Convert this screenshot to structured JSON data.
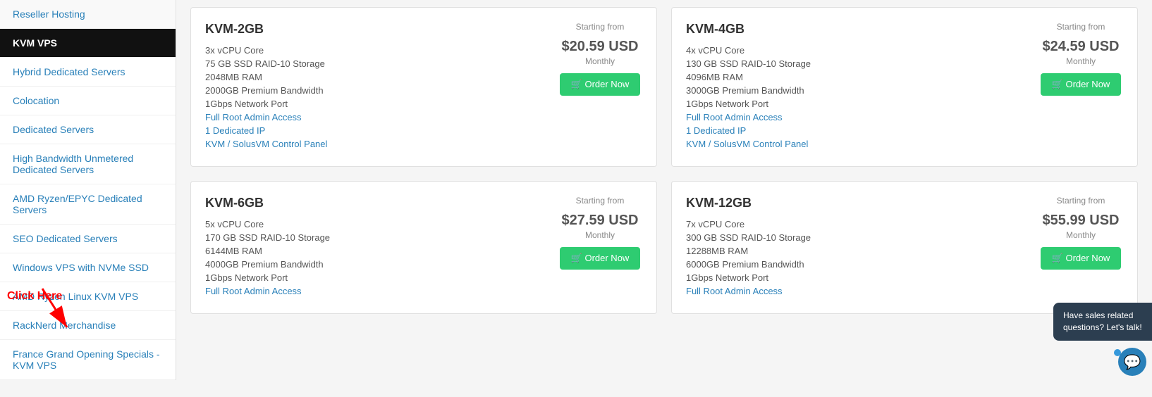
{
  "sidebar": {
    "items": [
      {
        "label": "Reseller Hosting",
        "active": false,
        "id": "reseller-hosting"
      },
      {
        "label": "KVM VPS",
        "active": true,
        "id": "kvm-vps"
      },
      {
        "label": "Hybrid Dedicated Servers",
        "active": false,
        "id": "hybrid-dedicated-servers"
      },
      {
        "label": "Colocation",
        "active": false,
        "id": "colocation"
      },
      {
        "label": "Dedicated Servers",
        "active": false,
        "id": "dedicated-servers"
      },
      {
        "label": "High Bandwidth Unmetered Dedicated Servers",
        "active": false,
        "id": "high-bandwidth-unmetered"
      },
      {
        "label": "AMD Ryzen/EPYC Dedicated Servers",
        "active": false,
        "id": "amd-ryzen-epyc"
      },
      {
        "label": "SEO Dedicated Servers",
        "active": false,
        "id": "seo-dedicated-servers"
      },
      {
        "label": "Windows VPS with NVMe SSD",
        "active": false,
        "id": "windows-vps-nvme"
      },
      {
        "label": "AMD Ryzen Linux KVM VPS",
        "active": false,
        "id": "amd-ryzen-linux-kvm"
      },
      {
        "label": "RackNerd Merchandise",
        "active": false,
        "id": "racknerd-merchandise"
      },
      {
        "label": "France Grand Opening Specials - KVM VPS",
        "active": false,
        "id": "france-grand-opening"
      }
    ],
    "click_annotation": "Click Here"
  },
  "products": [
    {
      "id": "kvm-2gb",
      "name": "KVM-2GB",
      "specs": [
        {
          "text": "3x vCPU Core",
          "highlight": false
        },
        {
          "text": "75 GB SSD RAID-10 Storage",
          "highlight": false
        },
        {
          "text": "2048MB RAM",
          "highlight": false
        },
        {
          "text": "2000GB Premium Bandwidth",
          "highlight": false
        },
        {
          "text": "1Gbps Network Port",
          "highlight": false
        },
        {
          "text": "Full Root Admin Access",
          "highlight": true
        },
        {
          "text": "1 Dedicated IP",
          "highlight": true
        },
        {
          "text": "KVM / SolusVM Control Panel",
          "highlight": true
        }
      ],
      "starting_from": "Starting from",
      "price": "$20.59 USD",
      "monthly": "Monthly",
      "order_label": "Order Now"
    },
    {
      "id": "kvm-4gb",
      "name": "KVM-4GB",
      "specs": [
        {
          "text": "4x vCPU Core",
          "highlight": false
        },
        {
          "text": "130 GB SSD RAID-10 Storage",
          "highlight": false
        },
        {
          "text": "4096MB RAM",
          "highlight": false
        },
        {
          "text": "3000GB Premium Bandwidth",
          "highlight": false
        },
        {
          "text": "1Gbps Network Port",
          "highlight": false
        },
        {
          "text": "Full Root Admin Access",
          "highlight": true
        },
        {
          "text": "1 Dedicated IP",
          "highlight": true
        },
        {
          "text": "KVM / SolusVM Control Panel",
          "highlight": true
        }
      ],
      "starting_from": "Starting from",
      "price": "$24.59 USD",
      "monthly": "Monthly",
      "order_label": "Order Now"
    },
    {
      "id": "kvm-6gb",
      "name": "KVM-6GB",
      "specs": [
        {
          "text": "5x vCPU Core",
          "highlight": false
        },
        {
          "text": "170 GB SSD RAID-10 Storage",
          "highlight": false
        },
        {
          "text": "6144MB RAM",
          "highlight": false
        },
        {
          "text": "4000GB Premium Bandwidth",
          "highlight": false
        },
        {
          "text": "1Gbps Network Port",
          "highlight": false
        },
        {
          "text": "Full Root Admin Access",
          "highlight": true
        }
      ],
      "starting_from": "Starting from",
      "price": "$27.59 USD",
      "monthly": "Monthly",
      "order_label": "Order Now"
    },
    {
      "id": "kvm-12gb",
      "name": "KVM-12GB",
      "specs": [
        {
          "text": "7x vCPU Core",
          "highlight": false
        },
        {
          "text": "300 GB SSD RAID-10 Storage",
          "highlight": false
        },
        {
          "text": "12288MB RAM",
          "highlight": false
        },
        {
          "text": "6000GB Premium Bandwidth",
          "highlight": false
        },
        {
          "text": "1Gbps Network Port",
          "highlight": false
        },
        {
          "text": "Full Root Admin Access",
          "highlight": true
        }
      ],
      "starting_from": "Starting from",
      "price": "$55.99 USD",
      "monthly": "Monthly",
      "order_label": "Order Now"
    }
  ],
  "chat": {
    "bubble_text": "Have sales related questions? Let's talk!",
    "icon": "💬"
  }
}
